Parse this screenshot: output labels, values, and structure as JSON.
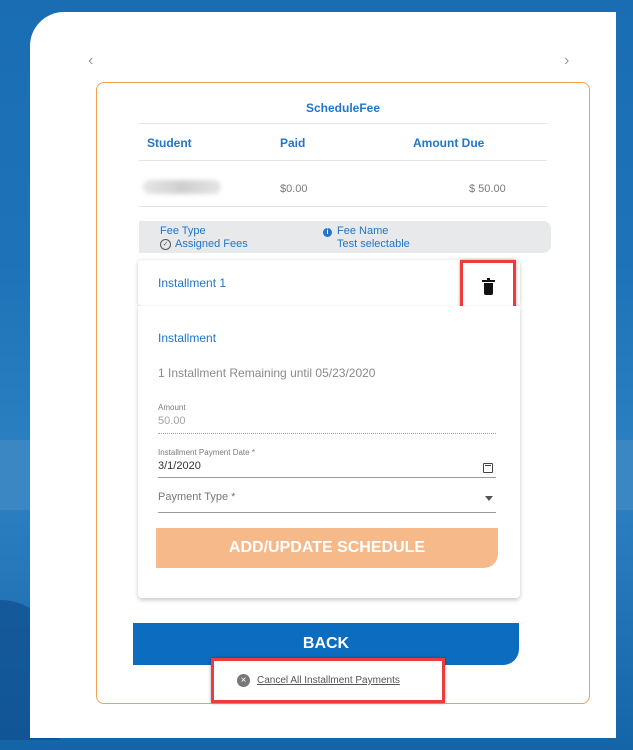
{
  "nav": {
    "prev": "‹",
    "next": "›"
  },
  "schedule": {
    "title": "ScheduleFee",
    "columns": {
      "student": "Student",
      "paid": "Paid",
      "amount_due": "Amount Due"
    },
    "row": {
      "paid": "$0.00",
      "amount_due": "$ 50.00"
    }
  },
  "fee": {
    "type_label": "Fee Type",
    "type_value": "Assigned Fees",
    "name_label": "Fee Name",
    "name_value": "Test selectable"
  },
  "installment": {
    "header": "Installment 1",
    "section_title": "Installment",
    "remaining": "1 Installment Remaining until 05/23/2020",
    "amount_label": "Amount",
    "amount_value": "50.00",
    "date_label": "Installment Payment Date *",
    "date_value": "3/1/2020",
    "payment_type_placeholder": "Payment Type *",
    "add_button": "ADD/UPDATE SCHEDULE"
  },
  "actions": {
    "back": "BACK",
    "cancel_all": "Cancel All Installment Payments"
  },
  "colors": {
    "accent": "#2176c7",
    "frame_border": "#f0a050",
    "add_button": "#f6b98a",
    "back_button": "#0c6cbf",
    "highlight": "#ee3b3b"
  }
}
